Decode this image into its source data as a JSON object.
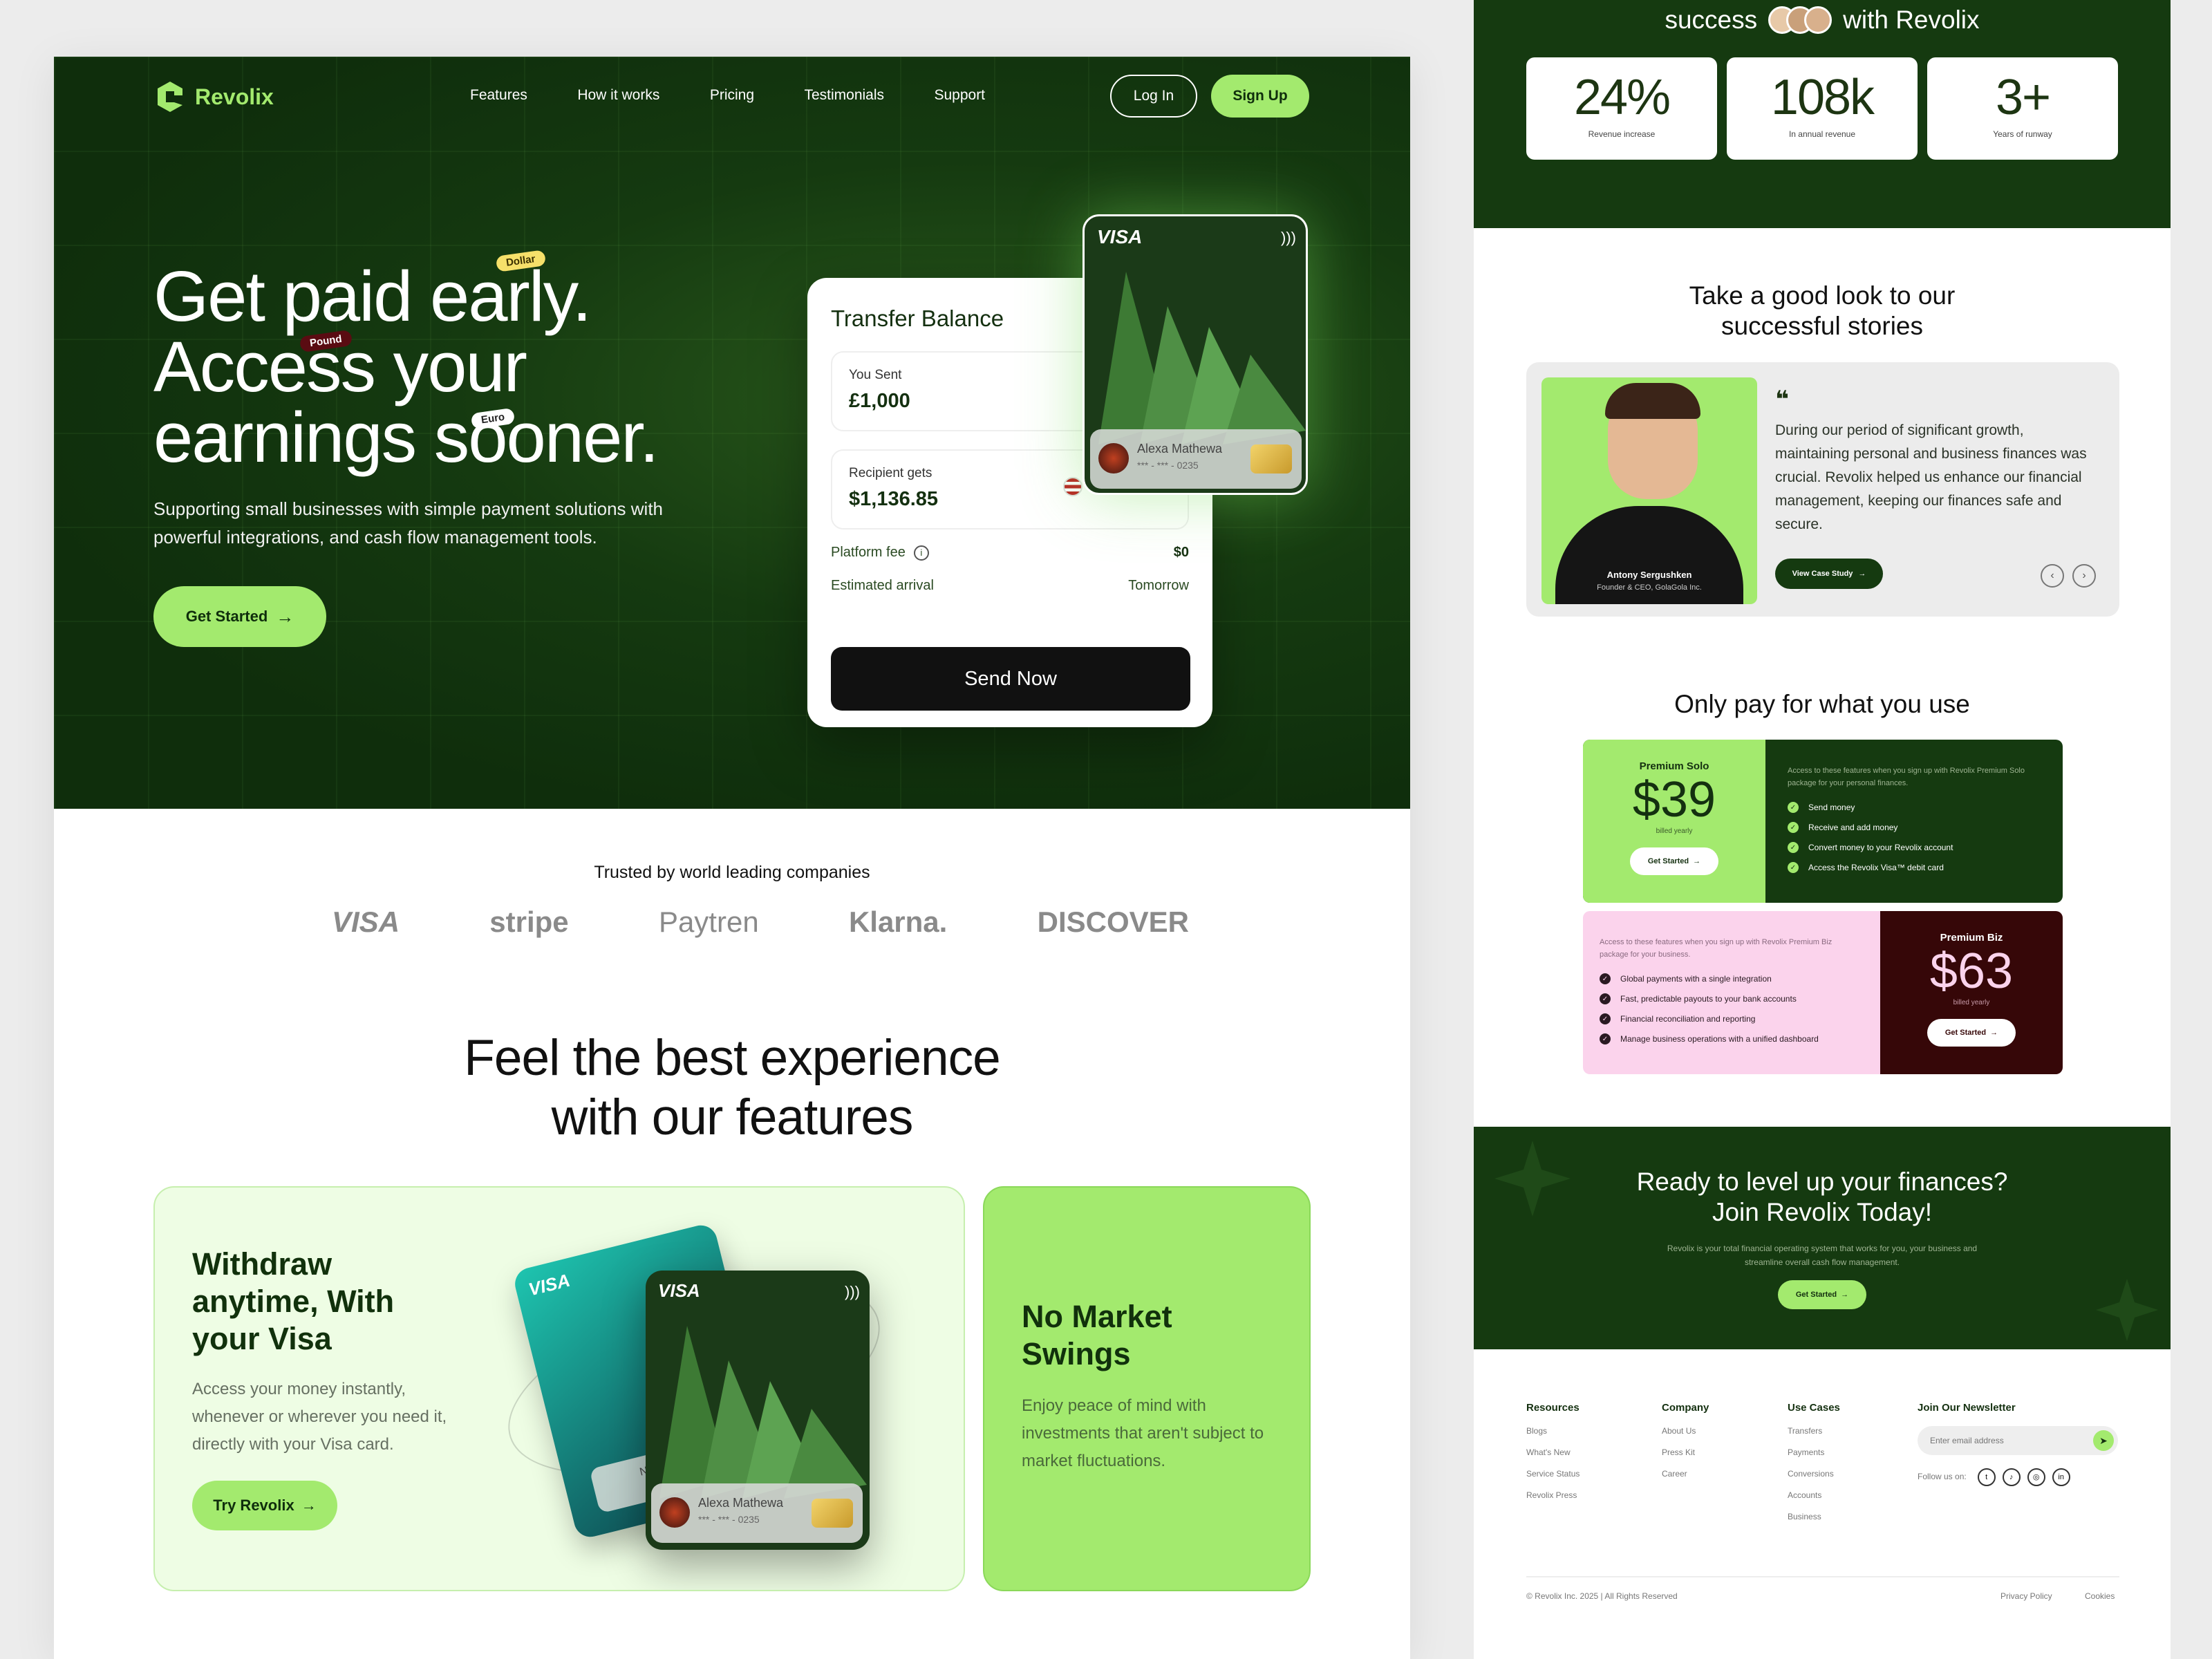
{
  "brand": {
    "name": "Revolix"
  },
  "nav": {
    "items": [
      "Features",
      "How it works",
      "Pricing",
      "Testimonials",
      "Support"
    ],
    "login": "Log In",
    "signup": "Sign Up"
  },
  "hero": {
    "line1": "Get paid early.",
    "line2": "Access your",
    "line3": "earnings sooner.",
    "tags": {
      "dollar": "Dollar",
      "pound": "Pound",
      "euro": "Euro"
    },
    "subtitle": "Supporting small businesses with simple payment solutions with powerful integrations, and cash flow management tools.",
    "cta": "Get Started"
  },
  "transfer": {
    "title": "Transfer Balance",
    "sent_label": "You Sent",
    "sent_value": "£1,000",
    "recipient_label": "Recipient gets",
    "recipient_value": "$1,136.85",
    "fee_label": "Platform fee",
    "fee_value": "$0",
    "arrival_label": "Estimated arrival",
    "arrival_value": "Tomorrow",
    "send": "Send Now"
  },
  "card": {
    "brand": "VISA",
    "holder": "Alexa Mathewa",
    "number": "*** - *** - 0235",
    "holder2": "Nath"
  },
  "trusted": {
    "title": "Trusted by world leading companies",
    "logos": [
      "VISA",
      "stripe",
      "Paytren",
      "Klarna.",
      "DISCOVER"
    ]
  },
  "features": {
    "title_line1": "Feel the best experience",
    "title_line2": "with our features",
    "f1": {
      "title": "Withdraw anytime, With your Visa",
      "body": "Access your money instantly, whenever or wherever you need it, directly with your Visa card.",
      "cta": "Try Revolix"
    },
    "f2": {
      "title": "No Market Swings",
      "body": "Enjoy peace of mind with investments that aren't subject to market fluctuations."
    }
  },
  "stats_header": {
    "word1": "success",
    "word2": "with Revolix"
  },
  "stats": [
    {
      "value": "24%",
      "label": "Revenue increase"
    },
    {
      "value": "108k",
      "label": "In annual revenue"
    },
    {
      "value": "3+",
      "label": "Years of runway"
    }
  ],
  "stories": {
    "title_line1": "Take a good look to our",
    "title_line2": "successful stories",
    "quote": "During our period of significant growth, maintaining personal and business finances was crucial. Revolix helped us enhance our financial management, keeping our finances safe and secure.",
    "person": "Antony Sergushken",
    "role": "Founder & CEO, GolaGola Inc.",
    "cta": "View Case Study"
  },
  "pricing": {
    "title": "Only pay for what you use",
    "solo": {
      "name": "Premium Solo",
      "price": "$39",
      "period": "billed yearly",
      "cta": "Get Started",
      "intro": "Access to these features when you sign up with Revolix Premium Solo package for your personal finances.",
      "features": [
        "Send money",
        "Receive and add money",
        "Convert money to your Revolix account",
        "Access the Revolix Visa™ debit card"
      ]
    },
    "biz": {
      "name": "Premium Biz",
      "price": "$63",
      "period": "billed yearly",
      "cta": "Get Started",
      "intro": "Access to these features when you sign up with Revolix Premium Biz package for your business.",
      "features": [
        "Global payments with a single integration",
        "Fast, predictable payouts to your bank accounts",
        "Financial reconciliation and reporting",
        "Manage business operations with a unified dashboard"
      ]
    }
  },
  "cta": {
    "line1": "Ready to level up your finances?",
    "line2": "Join Revolix Today!",
    "body": "Revolix is your total financial operating system that works for you, your business and streamline overall cash flow management.",
    "button": "Get Started"
  },
  "footer": {
    "resources": {
      "title": "Resources",
      "links": [
        "Blogs",
        "What's New",
        "Service Status",
        "Revolix Press"
      ]
    },
    "company": {
      "title": "Company",
      "links": [
        "About Us",
        "Press Kit",
        "Career"
      ]
    },
    "usecases": {
      "title": "Use Cases",
      "links": [
        "Transfers",
        "Payments",
        "Conversions",
        "Accounts",
        "Business"
      ]
    },
    "newsletter": {
      "title": "Join Our Newsletter",
      "placeholder": "Enter email address",
      "follow": "Follow us on:"
    },
    "copyright": "© Revolix Inc. 2025 | All Rights Reserved",
    "privacy": "Privacy Policy",
    "cookies": "Cookies"
  },
  "colors": {
    "dark_green": "#153a10",
    "lime": "#a3ea6e",
    "pink": "#fbd3ec",
    "maroon": "#360708"
  }
}
